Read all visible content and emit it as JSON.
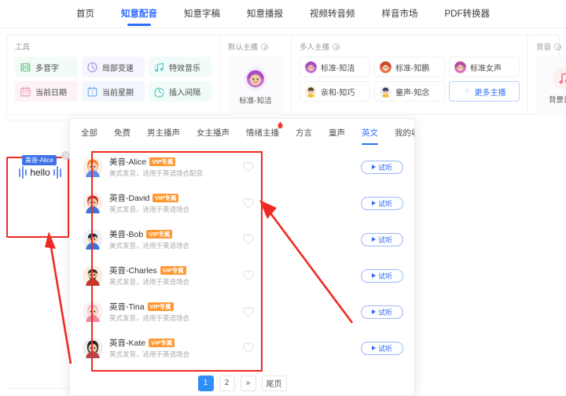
{
  "topnav": {
    "items": [
      {
        "label": "首页",
        "active": false
      },
      {
        "label": "知意配音",
        "active": true
      },
      {
        "label": "知意字稿",
        "active": false
      },
      {
        "label": "知意播报",
        "active": false
      },
      {
        "label": "视频转音频",
        "active": false
      },
      {
        "label": "样音市场",
        "active": false
      },
      {
        "label": "PDF转换器",
        "active": false
      }
    ]
  },
  "toolbar": {
    "tools_title": "工具",
    "tools": [
      {
        "label": "多音字",
        "icon": "polyphone-icon",
        "cls": "t-g"
      },
      {
        "label": "局部变速",
        "icon": "speed-clock-icon",
        "cls": "t-p"
      },
      {
        "label": "特效音乐",
        "icon": "music-note-icon",
        "cls": "t-t"
      },
      {
        "label": "当前日期",
        "icon": "calendar-icon",
        "cls": "t-k"
      },
      {
        "label": "当前星期",
        "icon": "weekday-icon",
        "cls": "t-b"
      },
      {
        "label": "插入间隔",
        "icon": "pause-clock-icon",
        "cls": "t-c"
      }
    ],
    "default_host_title": "默认主播",
    "default_host": {
      "name": "标准-知洁",
      "avatar": "avatar-purple"
    },
    "multi_host_title": "多人主播",
    "hosts": [
      {
        "label": "标准-知洁",
        "avatar": "avatar-purple"
      },
      {
        "label": "标准-知鹏",
        "avatar": "avatar-orange"
      },
      {
        "label": "标准女声",
        "avatar": "avatar-pink"
      },
      {
        "label": "亲和-知巧",
        "avatar": "avatar-yellow"
      },
      {
        "label": "童声-知念",
        "avatar": "avatar-blue"
      }
    ],
    "more_hosts_label": "更多主播",
    "bgm_title": "背音",
    "bgm_label": "背景音乐"
  },
  "editor": {
    "clip_label": "美音-Alice",
    "clip_text": "hello",
    "close_glyph": "×"
  },
  "panel": {
    "tabs": [
      {
        "label": "全部",
        "active": false,
        "hot": false
      },
      {
        "label": "免费",
        "active": false,
        "hot": false
      },
      {
        "label": "男主播声",
        "active": false,
        "hot": false
      },
      {
        "label": "女主播声",
        "active": false,
        "hot": false
      },
      {
        "label": "情绪主播",
        "active": false,
        "hot": true
      },
      {
        "label": "方言",
        "active": false,
        "hot": false
      },
      {
        "label": "童声",
        "active": false,
        "hot": false
      },
      {
        "label": "英文",
        "active": true,
        "hot": false
      },
      {
        "label": "我的收藏",
        "active": false,
        "hot": false
      }
    ],
    "voices": [
      {
        "name": "美音-Alice",
        "badge": "VIP专属",
        "desc": "美式发音，适用于英语场合配音",
        "listen": "试听",
        "avatar": "avatar-orange"
      },
      {
        "name": "英音-David",
        "badge": "VIP专属",
        "desc": "英式发音，适用于英语场合",
        "listen": "试听",
        "avatar": "avatar-red"
      },
      {
        "name": "美音-Bob",
        "badge": "VIP专属",
        "desc": "美式发音，适用于英语场合",
        "listen": "试听",
        "avatar": "avatar-navy"
      },
      {
        "name": "英音-Charles",
        "badge": "VIP专属",
        "desc": "英式发音，适用于英语场合",
        "listen": "试听",
        "avatar": "avatar-brown"
      },
      {
        "name": "英音-Tina",
        "badge": "VIP专属",
        "desc": "英式发音，适用于英语场合",
        "listen": "试听",
        "avatar": "avatar-pink"
      },
      {
        "name": "英音-Kate",
        "badge": "VIP专属",
        "desc": "英式发音，适用于英语场合",
        "listen": "试听",
        "avatar": "avatar-dark"
      }
    ],
    "pagination": [
      {
        "label": "1",
        "active": true
      },
      {
        "label": "2",
        "active": false
      },
      {
        "label": "»",
        "active": false
      },
      {
        "label": "尾页",
        "active": false
      }
    ]
  },
  "colors": {
    "accent": "#2f6bff",
    "vip": "#ff9833",
    "annotation": "#ee2a23",
    "pager_active": "#2f8ef7"
  }
}
